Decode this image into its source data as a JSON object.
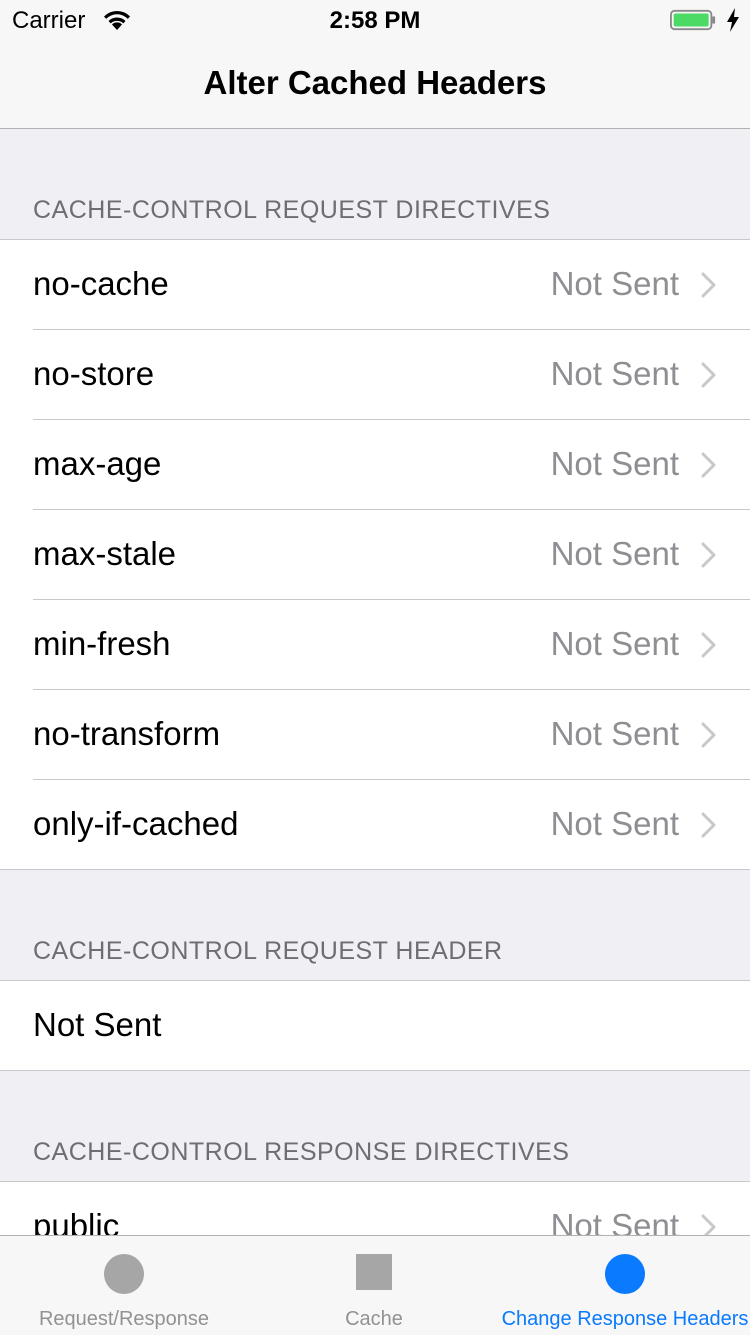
{
  "status_bar": {
    "carrier": "Carrier",
    "time": "2:58 PM",
    "battery_color": "#4cd964"
  },
  "nav": {
    "title": "Alter Cached Headers"
  },
  "sections": {
    "request_directives": {
      "header": "CACHE-CONTROL REQUEST DIRECTIVES",
      "rows": [
        {
          "label": "no-cache",
          "value": "Not Sent"
        },
        {
          "label": "no-store",
          "value": "Not Sent"
        },
        {
          "label": "max-age",
          "value": "Not Sent"
        },
        {
          "label": "max-stale",
          "value": "Not Sent"
        },
        {
          "label": "min-fresh",
          "value": "Not Sent"
        },
        {
          "label": "no-transform",
          "value": "Not Sent"
        },
        {
          "label": "only-if-cached",
          "value": "Not Sent"
        }
      ]
    },
    "request_header": {
      "header": "CACHE-CONTROL REQUEST HEADER",
      "value": "Not Sent"
    },
    "response_directives": {
      "header": "CACHE-CONTROL RESPONSE DIRECTIVES",
      "rows": [
        {
          "label": "public",
          "value": "Not Sent"
        }
      ]
    }
  },
  "tab_bar": {
    "tabs": [
      {
        "label": "Request/Response",
        "icon": "circle-icon",
        "active": false
      },
      {
        "label": "Cache",
        "icon": "square-icon",
        "active": false
      },
      {
        "label": "Change Response Headers",
        "icon": "circle-icon",
        "active": true
      }
    ],
    "accent_color": "#0a7aff",
    "inactive_color": "#929292"
  }
}
